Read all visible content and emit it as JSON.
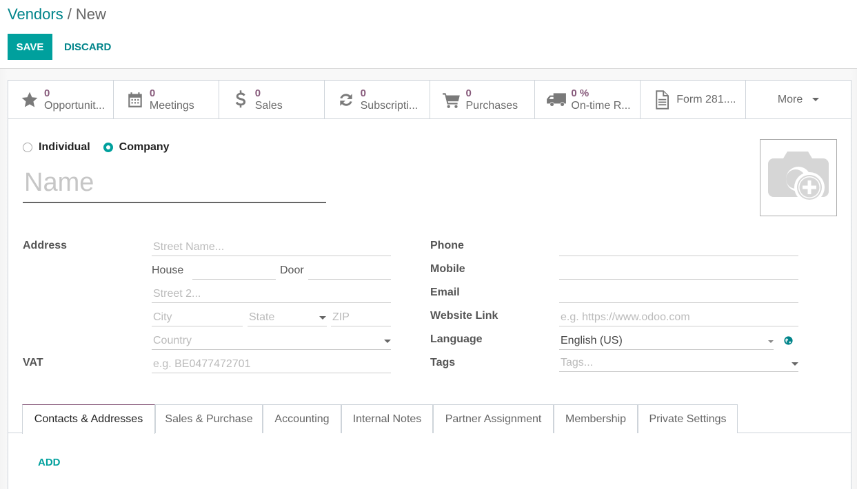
{
  "breadcrumb": {
    "parent": "Vendors",
    "separator": "/",
    "current": "New"
  },
  "toolbar": {
    "save_label": "SAVE",
    "discard_label": "DISCARD"
  },
  "colors": {
    "primary": "#00a09d",
    "link": "#00848a",
    "accent": "#875a7b"
  },
  "stat_buttons": [
    {
      "icon": "star-icon",
      "value": "0",
      "label": "Opportunit..."
    },
    {
      "icon": "calendar-icon",
      "value": "0",
      "label": "Meetings"
    },
    {
      "icon": "dollar-icon",
      "value": "0",
      "label": "Sales"
    },
    {
      "icon": "refresh-icon",
      "value": "0",
      "label": "Subscripti..."
    },
    {
      "icon": "shopping-cart-icon",
      "value": "0",
      "label": "Purchases"
    },
    {
      "icon": "truck-icon",
      "value": "0 %",
      "label": "On-time R..."
    },
    {
      "icon": "file-text-icon",
      "label": "Form 281...."
    }
  ],
  "more_label": "More",
  "company_type": {
    "options": [
      "Individual",
      "Company"
    ],
    "selected": "Company"
  },
  "name_placeholder": "Name",
  "address": {
    "label": "Address",
    "street_placeholder": "Street Name...",
    "house_label": "House",
    "house_value": "",
    "door_label": "Door",
    "door_value": "",
    "street2_placeholder": "Street 2...",
    "city_placeholder": "City",
    "state_placeholder": "State",
    "zip_placeholder": "ZIP",
    "country_placeholder": "Country"
  },
  "vat": {
    "label": "VAT",
    "placeholder": "e.g. BE0477472701"
  },
  "contact": {
    "phone_label": "Phone",
    "phone_value": "",
    "mobile_label": "Mobile",
    "mobile_value": "",
    "email_label": "Email",
    "email_value": "",
    "website_label": "Website Link",
    "website_placeholder": "e.g. https://www.odoo.com",
    "language_label": "Language",
    "language_value": "English (US)",
    "tags_label": "Tags",
    "tags_placeholder": "Tags..."
  },
  "tabs": [
    "Contacts & Addresses",
    "Sales & Purchase",
    "Accounting",
    "Internal Notes",
    "Partner Assignment",
    "Membership",
    "Private Settings"
  ],
  "active_tab": "Contacts & Addresses",
  "add_label": "ADD"
}
